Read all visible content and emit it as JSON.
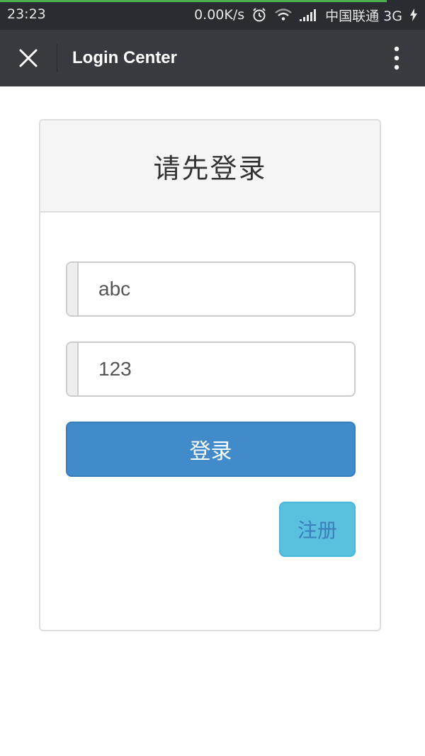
{
  "status_bar": {
    "time": "23:23",
    "speed": "0.00K/s",
    "carrier": "中国联通 3G",
    "icons": [
      "alarm-icon",
      "wifi-icon",
      "signal-icon",
      "charging-icon"
    ]
  },
  "app_bar": {
    "title": "Login Center",
    "close_icon": "close-icon",
    "more_icon": "more-vertical-icon"
  },
  "panel": {
    "heading": "请先登录"
  },
  "form": {
    "username_value": "abc",
    "password_value": "123",
    "login_label": "登录",
    "register_label": "注册"
  },
  "colors": {
    "status_bar_bg": "#2b2c31",
    "app_bar_bg": "#393a3f",
    "primary": "#428bca",
    "info": "#5bc0de",
    "progress": "#4caf50"
  }
}
